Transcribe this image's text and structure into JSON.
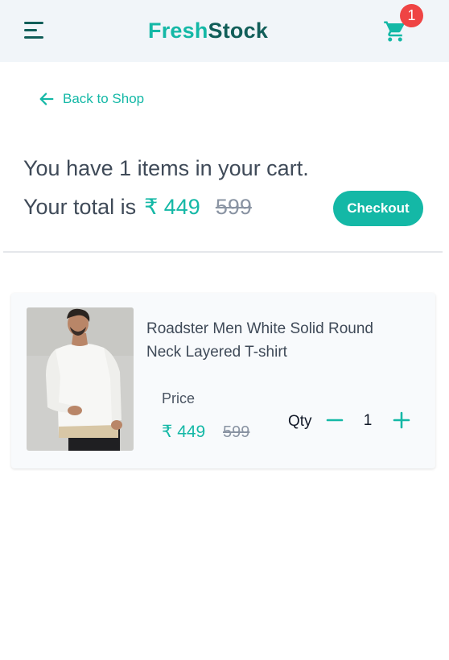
{
  "header": {
    "brand_part1": "Fresh",
    "brand_part2": "Stock",
    "cart_count": "1",
    "menu_icon": "hamburger-menu-icon",
    "cart_icon": "shopping-cart-icon"
  },
  "nav": {
    "back_label": "Back to Shop",
    "back_icon": "arrow-left-icon"
  },
  "summary": {
    "line1": "You have 1 items in your cart.",
    "total_prefix": "Your total is",
    "total_price": "₹ 449",
    "total_original": "599",
    "checkout_label": "Checkout"
  },
  "cart_items": [
    {
      "name": "Roadster Men White Solid Round Neck Layered T-shirt",
      "price_label": "Price",
      "price": "₹ 449",
      "original_price": "599",
      "qty_label": "Qty",
      "quantity": "1"
    }
  ],
  "colors": {
    "accent": "#14b8a6",
    "brand_dark": "#115e59",
    "badge": "#ef4444",
    "header_bg": "#f1f5f9",
    "strikethrough": "#8a94a3"
  }
}
